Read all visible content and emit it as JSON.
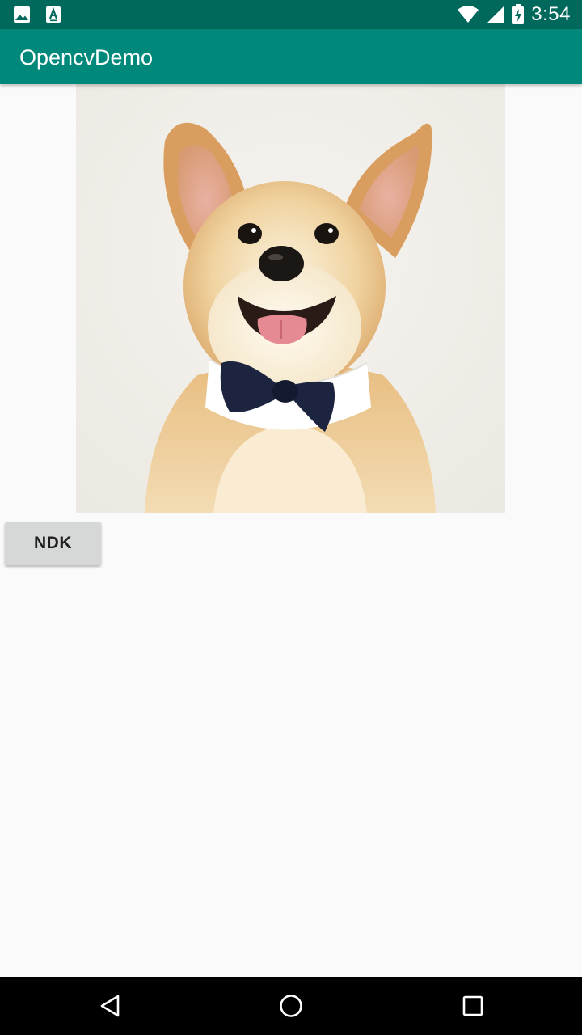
{
  "status_bar": {
    "time": "3:54",
    "icons": [
      "image-notification-icon",
      "text-notification-icon",
      "wifi-icon",
      "cell-signal-icon",
      "battery-charging-icon"
    ],
    "background": "#00695c"
  },
  "app_bar": {
    "title": "OpencvDemo",
    "background": "#00897b"
  },
  "main": {
    "image": {
      "subject": "corgi-with-bowtie"
    },
    "ndk_button_label": "NDK"
  },
  "nav_bar": {
    "icons": [
      "back-icon",
      "home-icon",
      "recents-icon"
    ]
  }
}
